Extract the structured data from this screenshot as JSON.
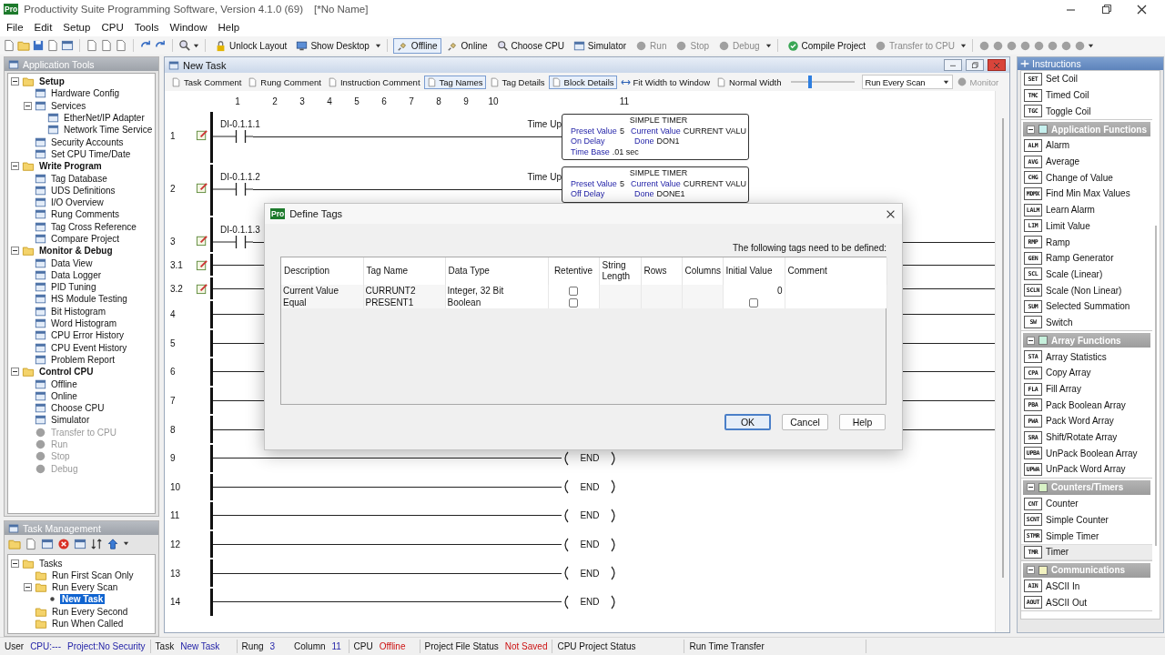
{
  "title_bar": {
    "icon_text": "Pro",
    "title": "Productivity Suite Programming Software, Version 4.1.0 (69)",
    "document": "[*No Name]"
  },
  "menu": [
    "File",
    "Edit",
    "Setup",
    "CPU",
    "Tools",
    "Window",
    "Help"
  ],
  "toolbar": [
    {
      "label": "Unlock Layout",
      "selected": false,
      "disabled": false,
      "dropdown": false
    },
    {
      "label": "Show Desktop",
      "selected": false,
      "disabled": false,
      "dropdown": true
    },
    {
      "label": "Offline",
      "selected": true,
      "disabled": false,
      "dropdown": false
    },
    {
      "label": "Online",
      "selected": false,
      "disabled": false,
      "dropdown": false
    },
    {
      "label": "Choose CPU",
      "selected": false,
      "disabled": false,
      "dropdown": false
    },
    {
      "label": "Simulator",
      "selected": false,
      "disabled": false,
      "dropdown": false
    },
    {
      "label": "Run",
      "selected": false,
      "disabled": true,
      "dropdown": false
    },
    {
      "label": "Stop",
      "selected": false,
      "disabled": true,
      "dropdown": false
    },
    {
      "label": "Debug",
      "selected": false,
      "disabled": true,
      "dropdown": true
    },
    {
      "label": "Compile Project",
      "selected": false,
      "disabled": false,
      "dropdown": false
    },
    {
      "label": "Transfer to CPU",
      "selected": false,
      "disabled": true,
      "dropdown": true
    }
  ],
  "application_tools": {
    "title": "Application Tools",
    "tree": [
      {
        "label": "Setup",
        "expanded": true,
        "children": [
          {
            "label": "Hardware Config"
          },
          {
            "label": "Services",
            "expanded": true,
            "children": [
              {
                "label": "EtherNet/IP Adapter"
              },
              {
                "label": "Network Time Service"
              }
            ]
          },
          {
            "label": "Security Accounts"
          },
          {
            "label": "Set CPU Time/Date"
          }
        ]
      },
      {
        "label": "Write Program",
        "expanded": true,
        "children": [
          {
            "label": "Tag Database"
          },
          {
            "label": "UDS Definitions"
          },
          {
            "label": "I/O Overview"
          },
          {
            "label": "Rung Comments"
          },
          {
            "label": "Tag Cross Reference"
          },
          {
            "label": "Compare Project"
          }
        ]
      },
      {
        "label": "Monitor & Debug",
        "expanded": true,
        "children": [
          {
            "label": "Data View"
          },
          {
            "label": "Data Logger"
          },
          {
            "label": "PID Tuning"
          },
          {
            "label": "HS Module Testing"
          },
          {
            "label": "Bit Histogram"
          },
          {
            "label": "Word Histogram"
          },
          {
            "label": "CPU Error History"
          },
          {
            "label": "CPU Event History"
          },
          {
            "label": "Problem Report"
          }
        ]
      },
      {
        "label": "Control CPU",
        "expanded": true,
        "children": [
          {
            "label": "Offline",
            "disabled": false
          },
          {
            "label": "Online",
            "disabled": false
          },
          {
            "label": "Choose CPU",
            "disabled": false
          },
          {
            "label": "Simulator",
            "disabled": false
          },
          {
            "label": "Transfer to CPU",
            "disabled": true
          },
          {
            "label": "Run",
            "disabled": true
          },
          {
            "label": "Stop",
            "disabled": true
          },
          {
            "label": "Debug",
            "disabled": true
          }
        ]
      }
    ]
  },
  "task_management": {
    "title": "Task Management",
    "tree": [
      {
        "label": "Tasks",
        "expanded": true,
        "selected": false,
        "children": [
          {
            "label": "Run First Scan Only",
            "selected": false
          },
          {
            "label": "Run Every Scan",
            "expanded": true,
            "selected": false,
            "children": [
              {
                "label": "New Task",
                "selected": true
              }
            ]
          },
          {
            "label": "Run Every Second",
            "selected": false
          },
          {
            "label": "Run When Called",
            "selected": false
          }
        ]
      }
    ]
  },
  "editor": {
    "title": "New Task",
    "toolbar": [
      {
        "label": "Task Comment",
        "selected": false
      },
      {
        "label": "Rung Comment",
        "selected": false
      },
      {
        "label": "Instruction Comment",
        "selected": false
      },
      {
        "label": "Tag Names",
        "selected": true
      },
      {
        "label": "Tag Details",
        "selected": false
      },
      {
        "label": "Block Details",
        "selected": true
      },
      {
        "label": "Fit Width to Window",
        "selected": false
      },
      {
        "label": "Normal Width",
        "selected": false
      }
    ],
    "zoom_slider": {
      "level": 0.3
    },
    "scan_select": {
      "value": "Run Every Scan"
    },
    "monitor": {
      "label": "Monitor",
      "disabled": true
    },
    "column_numbers": [
      "1",
      "2",
      "3",
      "4",
      "5",
      "6",
      "7",
      "8",
      "9",
      "10",
      "11"
    ],
    "rungs": [
      {
        "number": "1",
        "kind": "contact",
        "comment": true,
        "tag": "DI-0.1.1.1",
        "input_label": "Time Up",
        "output": {
          "title": "SIMPLE TIMER",
          "rows": [
            [
              {
                "label": "Preset Value",
                "value": "5"
              },
              {
                "label": "Current Value",
                "value": "CURRENT VALU"
              }
            ],
            [
              {
                "label": "On Delay"
              },
              {
                "label": "Done",
                "value": "DON1"
              }
            ],
            [
              {
                "label": "Time Base",
                "value": ".01 sec"
              }
            ]
          ]
        }
      },
      {
        "number": "2",
        "kind": "contact",
        "comment": true,
        "tag": "DI-0.1.1.2",
        "input_label": "Time Up",
        "output": {
          "title": "SIMPLE TIMER",
          "rows": [
            [
              {
                "label": "Preset Value",
                "value": "5"
              },
              {
                "label": "Current Value",
                "value": "CURRENT VALU"
              }
            ],
            [
              {
                "label": "Off Delay"
              },
              {
                "label": "Done",
                "value": "DONE1"
              }
            ]
          ]
        }
      },
      {
        "number": "3",
        "kind": "contact",
        "comment": true,
        "tag": "DI-0.1.1.3"
      },
      {
        "number": "3.1",
        "kind": "branch",
        "comment": true
      },
      {
        "number": "3.2",
        "kind": "branch",
        "comment": true
      },
      {
        "number": "4",
        "kind": "empty",
        "comment": false
      },
      {
        "number": "5",
        "kind": "empty",
        "comment": false
      },
      {
        "number": "6",
        "kind": "empty",
        "comment": false
      },
      {
        "number": "7",
        "kind": "empty",
        "comment": false
      },
      {
        "number": "8",
        "kind": "empty",
        "comment": false
      },
      {
        "number": "9",
        "kind": "end",
        "comment": false,
        "instruction": "END"
      },
      {
        "number": "10",
        "kind": "end",
        "comment": false,
        "instruction": "END"
      },
      {
        "number": "11",
        "kind": "end",
        "comment": false,
        "instruction": "END"
      },
      {
        "number": "12",
        "kind": "end",
        "comment": false,
        "instruction": "END"
      },
      {
        "number": "13",
        "kind": "end",
        "comment": false,
        "instruction": "END"
      },
      {
        "number": "14",
        "kind": "end",
        "comment": false,
        "instruction": "END"
      }
    ]
  },
  "instructions": {
    "title": "Instructions",
    "groups": [
      {
        "items": [
          {
            "code": "SET",
            "label": "Set Coil",
            "selected": false
          },
          {
            "code": "TMC",
            "label": "Timed Coil",
            "selected": false
          },
          {
            "code": "TGC",
            "label": "Toggle Coil",
            "selected": false
          }
        ]
      },
      {
        "title": "Application Functions",
        "expanded": true,
        "color": "#c6f0ee",
        "items": [
          {
            "code": "ALM",
            "label": "Alarm",
            "selected": false
          },
          {
            "code": "AVG",
            "label": "Average",
            "selected": false
          },
          {
            "code": "CHG",
            "label": "Change of Value",
            "selected": false
          },
          {
            "code": "MDMX",
            "label": "Find Min Max Values",
            "selected": false
          },
          {
            "code": "LALM",
            "label": "Learn Alarm",
            "selected": false
          },
          {
            "code": "LIM",
            "label": "Limit Value",
            "selected": false
          },
          {
            "code": "RMP",
            "label": "Ramp",
            "selected": false
          },
          {
            "code": "GEN",
            "label": "Ramp Generator",
            "selected": false
          },
          {
            "code": "SCL",
            "label": "Scale (Linear)",
            "selected": false
          },
          {
            "code": "SCLN",
            "label": "Scale (Non Linear)",
            "selected": false
          },
          {
            "code": "SUM",
            "label": "Selected Summation",
            "selected": false
          },
          {
            "code": "SW",
            "label": "Switch",
            "selected": false
          }
        ]
      },
      {
        "title": "Array Functions",
        "expanded": true,
        "color": "#c6f0dc",
        "items": [
          {
            "code": "STA",
            "label": "Array Statistics",
            "selected": false
          },
          {
            "code": "CPA",
            "label": "Copy Array",
            "selected": false
          },
          {
            "code": "FLA",
            "label": "Fill Array",
            "selected": false
          },
          {
            "code": "PBA",
            "label": "Pack Boolean Array",
            "selected": false
          },
          {
            "code": "PWA",
            "label": "Pack Word Array",
            "selected": false
          },
          {
            "code": "SRA",
            "label": "Shift/Rotate Array",
            "selected": false
          },
          {
            "code": "UPBA",
            "label": "UnPack Boolean Array",
            "selected": false
          },
          {
            "code": "UPWA",
            "label": "UnPack Word Array",
            "selected": false
          }
        ]
      },
      {
        "title": "Counters/Timers",
        "expanded": true,
        "color": "#d8f2c6",
        "items": [
          {
            "code": "CNT",
            "label": "Counter",
            "selected": false
          },
          {
            "code": "SCNT",
            "label": "Simple Counter",
            "selected": false
          },
          {
            "code": "STMR",
            "label": "Simple Timer",
            "selected": false
          },
          {
            "code": "TMR",
            "label": "Timer",
            "selected": true
          }
        ]
      },
      {
        "title": "Communications",
        "expanded": true,
        "color": "#f2f2c0",
        "items": [
          {
            "code": "AIN",
            "label": "ASCII In",
            "selected": false
          },
          {
            "code": "AOUT",
            "label": "ASCII Out",
            "selected": false
          }
        ]
      }
    ]
  },
  "dialog": {
    "title": "Define Tags",
    "icon_text": "Pro",
    "note": "The following tags need to be defined:",
    "columns": [
      "Description",
      "Tag Name",
      "Data Type",
      "Retentive",
      "String Length",
      "Rows",
      "Columns",
      "Initial Value",
      "Comment"
    ],
    "rows": [
      {
        "description": "Current Value",
        "tag_name": "CURRUNT2",
        "data_type": "Integer, 32 Bit",
        "retentive": false,
        "initial_value": "0"
      },
      {
        "description": "Equal",
        "tag_name": "PRESENT1",
        "data_type": "Boolean",
        "retentive": false,
        "initial_checked": false
      }
    ],
    "buttons": [
      {
        "label": "OK",
        "default": true
      },
      {
        "label": "Cancel",
        "default": false
      },
      {
        "label": "Help",
        "default": false
      }
    ]
  },
  "status_bar": [
    {
      "fields": [
        {
          "text": "User",
          "kind": "label"
        },
        {
          "text": "CPU:---",
          "kind": "value"
        },
        {
          "text": "Project:No Security",
          "kind": "value"
        }
      ]
    },
    {
      "fields": [
        {
          "text": "Task",
          "kind": "label"
        },
        {
          "text": "New Task",
          "kind": "value"
        }
      ]
    },
    {
      "fields": [
        {
          "text": "Rung",
          "kind": "label"
        },
        {
          "text": "3",
          "kind": "value"
        },
        {
          "text": "Column",
          "kind": "label"
        },
        {
          "text": "11",
          "kind": "value"
        }
      ]
    },
    {
      "fields": [
        {
          "text": "CPU",
          "kind": "label"
        },
        {
          "text": "Offline",
          "kind": "warning"
        }
      ]
    },
    {
      "fields": [
        {
          "text": "Project File Status",
          "kind": "label"
        },
        {
          "text": "Not Saved",
          "kind": "warning"
        }
      ]
    },
    {
      "fields": [
        {
          "text": "CPU Project Status",
          "kind": "label"
        }
      ]
    },
    {
      "fields": [
        {
          "text": "Run Time Transfer",
          "kind": "label"
        }
      ]
    }
  ]
}
